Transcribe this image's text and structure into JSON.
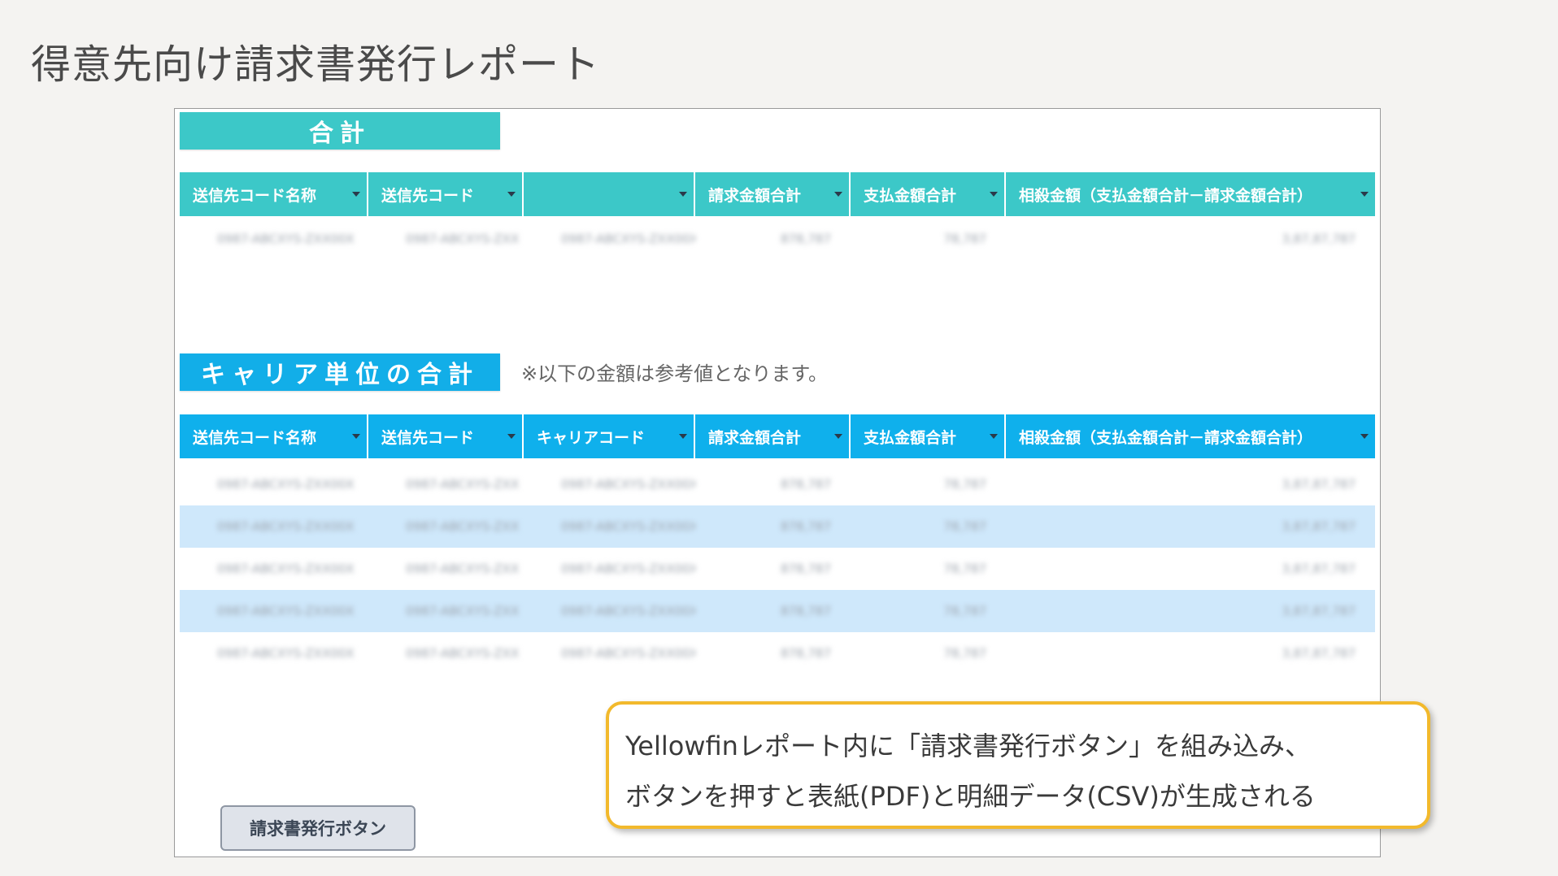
{
  "slide": {
    "title": "得意先向け請求書発行レポート"
  },
  "summary_section": {
    "banner": "合計",
    "columns": [
      "送信先コード名称",
      "送信先コード",
      "",
      "請求金額合計",
      "支払金額合計",
      "相殺金額（支払金額合計－請求金額合計）"
    ],
    "rows": [
      [
        "0987-ABCXYS-ZXX00X",
        "0987-ABCXYS-ZXX",
        "0987-ABCXYS-ZXX00X",
        "878,787",
        "78,787",
        "3,87,87,787"
      ]
    ]
  },
  "carrier_section": {
    "banner": "キャリア単位の合計",
    "note": "※以下の金額は参考値となります。",
    "columns": [
      "送信先コード名称",
      "送信先コード",
      "キャリアコード",
      "請求金額合計",
      "支払金額合計",
      "相殺金額（支払金額合計－請求金額合計）"
    ],
    "rows": [
      [
        "0987-ABCXYS-ZXX00X",
        "0987-ABCXYS-ZXX",
        "0987-ABCXYS-ZXX00X",
        "878,787",
        "78,787",
        "3,87,87,787"
      ],
      [
        "0987-ABCXYS-ZXX00X",
        "0987-ABCXYS-ZXX",
        "0987-ABCXYS-ZXX00X",
        "878,787",
        "78,787",
        "3,87,87,787"
      ],
      [
        "0987-ABCXYS-ZXX00X",
        "0987-ABCXYS-ZXX",
        "0987-ABCXYS-ZXX00X",
        "878,787",
        "78,787",
        "3,87,87,787"
      ],
      [
        "0987-ABCXYS-ZXX00X",
        "0987-ABCXYS-ZXX",
        "0987-ABCXYS-ZXX00X",
        "878,787",
        "78,787",
        "3,87,87,787"
      ],
      [
        "0987-ABCXYS-ZXX00X",
        "0987-ABCXYS-ZXX",
        "0987-ABCXYS-ZXX00X",
        "878,787",
        "78,787",
        "3,87,87,787"
      ]
    ]
  },
  "issue_button": {
    "label": "請求書発行ボタン"
  },
  "callout": {
    "lines": [
      "Yellowfinレポート内に「請求書発行ボタン」を組み込み、",
      "ボタンを押すと表紙(PDF)と明細データ(CSV)が生成される"
    ]
  },
  "colors": {
    "summary_accent": "#3cc8c8",
    "carrier_accent": "#0fb0ec",
    "stripe": "#cfe8fb",
    "callout_border": "#f2b92c"
  }
}
